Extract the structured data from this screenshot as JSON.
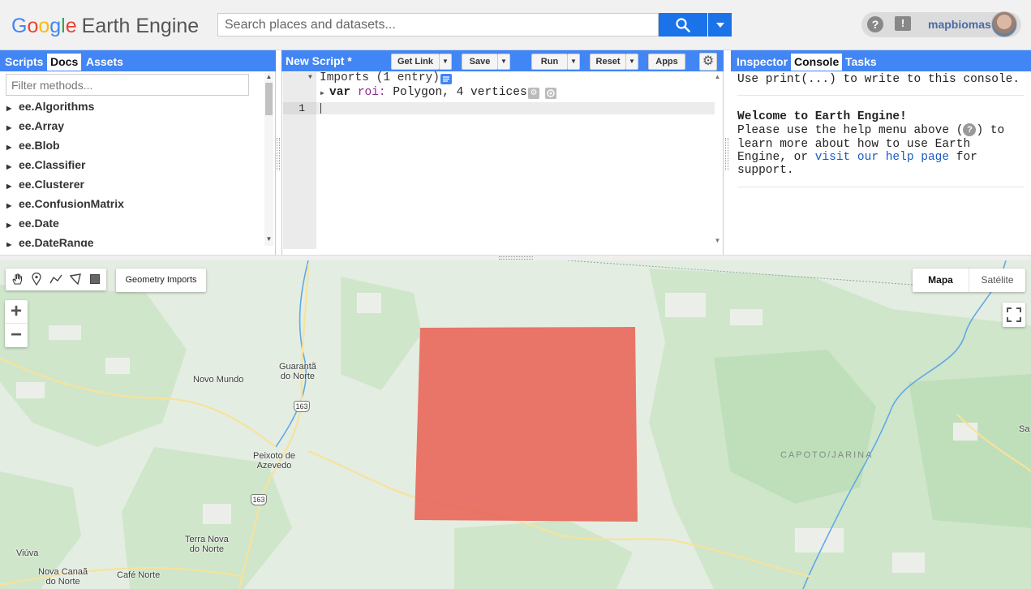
{
  "header": {
    "logo_google": [
      "G",
      "o",
      "o",
      "g",
      "l",
      "e"
    ],
    "logo_product": "Earth Engine",
    "search_placeholder": "Search places and datasets...",
    "username": "mapbiomas",
    "help_symbol": "?",
    "feedback_symbol": "!"
  },
  "left_panel": {
    "tabs": [
      "Scripts",
      "Docs",
      "Assets"
    ],
    "active_tab": "Docs",
    "filter_placeholder": "Filter methods...",
    "items": [
      "ee.Algorithms",
      "ee.Array",
      "ee.Blob",
      "ee.Classifier",
      "ee.Clusterer",
      "ee.ConfusionMatrix",
      "ee.Date",
      "ee.DateRange"
    ]
  },
  "editor": {
    "title": "New Script *",
    "buttons": {
      "get_link": "Get Link",
      "save": "Save",
      "run": "Run",
      "reset": "Reset",
      "apps": "Apps"
    },
    "imports_header": "Imports (1 entry)",
    "import_keyword": "var",
    "import_name": "roi:",
    "import_desc": "Polygon, 4 vertices",
    "line_number": "1"
  },
  "right_panel": {
    "tabs": [
      "Inspector",
      "Console",
      "Tasks"
    ],
    "active_tab": "Console",
    "console_hint": "Use print(...) to write to this console.",
    "welcome_title": "Welcome to Earth Engine!",
    "welcome_line1_pre": "Please use the help menu above (",
    "welcome_line1_post": ") to",
    "welcome_line2": "learn more about how to use Earth",
    "welcome_line3_pre": "Engine, or ",
    "welcome_link": "visit our help page",
    "welcome_line3_post": " for",
    "welcome_line4": "support."
  },
  "map": {
    "geometry_imports_label": "Geometry Imports",
    "zoom_in": "+",
    "zoom_out": "−",
    "map_types": [
      "Mapa",
      "Satélite"
    ],
    "active_map_type": "Mapa",
    "places": {
      "novo_mundo": "Novo Mundo",
      "guaranta_1": "Guarantã",
      "guaranta_2": "do Norte",
      "peixoto_1": "Peixoto de",
      "peixoto_2": "Azevedo",
      "terra_nova_1": "Terra Nova",
      "terra_nova_2": "do Norte",
      "viuva": "Viúva",
      "nova_canaa_1": "Nova Canaã",
      "nova_canaa_2": "do Norte",
      "cafe_norte": "Café Norte",
      "sa": "Sa"
    },
    "region_label": "CAPOTO/JARINA",
    "road_shield_1": "163",
    "road_shield_2": "163",
    "roi_color": "#e8675a",
    "river_color": "#62a8e6"
  },
  "colors": {
    "accent": "#4285f4",
    "search_button": "#1a73e8",
    "link": "#1a5bc4"
  }
}
